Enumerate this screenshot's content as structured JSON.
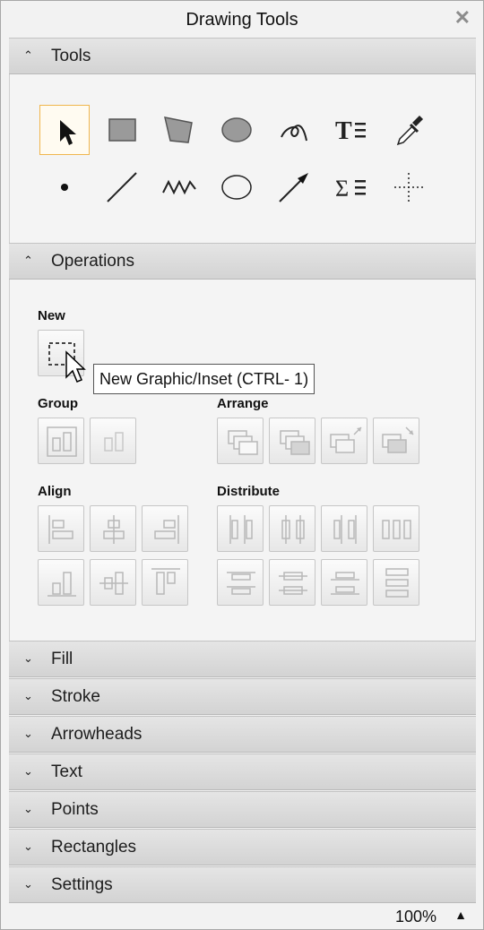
{
  "window": {
    "title": "Drawing Tools",
    "close_glyph": "✕"
  },
  "sections": {
    "tools": {
      "label": "Tools",
      "chevron": "⌃"
    },
    "operations": {
      "label": "Operations",
      "chevron": "⌃"
    },
    "fill": {
      "label": "Fill",
      "chevron": "⌄"
    },
    "stroke": {
      "label": "Stroke",
      "chevron": "⌄"
    },
    "arrowheads": {
      "label": "Arrowheads",
      "chevron": "⌄"
    },
    "text": {
      "label": "Text",
      "chevron": "⌄"
    },
    "points": {
      "label": "Points",
      "chevron": "⌄"
    },
    "rectangles": {
      "label": "Rectangles",
      "chevron": "⌄"
    },
    "settings": {
      "label": "Settings",
      "chevron": "⌄"
    }
  },
  "tools": {
    "row1": [
      "select-arrow-icon",
      "rectangle-icon",
      "polygon-icon",
      "ellipse-icon",
      "freehand-curve-icon",
      "text-icon",
      "eyedropper-icon"
    ],
    "row2": [
      "point-icon",
      "line-icon",
      "polyline-icon",
      "circle-outline-icon",
      "arrow-line-icon",
      "math-text-icon",
      "crosshair-icon"
    ],
    "math_glyph": "Σ",
    "text_glyph": "T",
    "selected": "select-arrow-icon"
  },
  "operations": {
    "new_label": "New",
    "group_label": "Group",
    "arrange_label": "Arrange",
    "align_label": "Align",
    "distribute_label": "Distribute",
    "tooltip": "New Graphic/Inset (CTRL- 1)"
  },
  "status": {
    "zoom": "100%",
    "zoom_arrow": "▲"
  },
  "colors": {
    "selected_border": "#f0b64d",
    "header_bg": "#dcdcdc",
    "panel_bg": "#f4f4f4"
  }
}
